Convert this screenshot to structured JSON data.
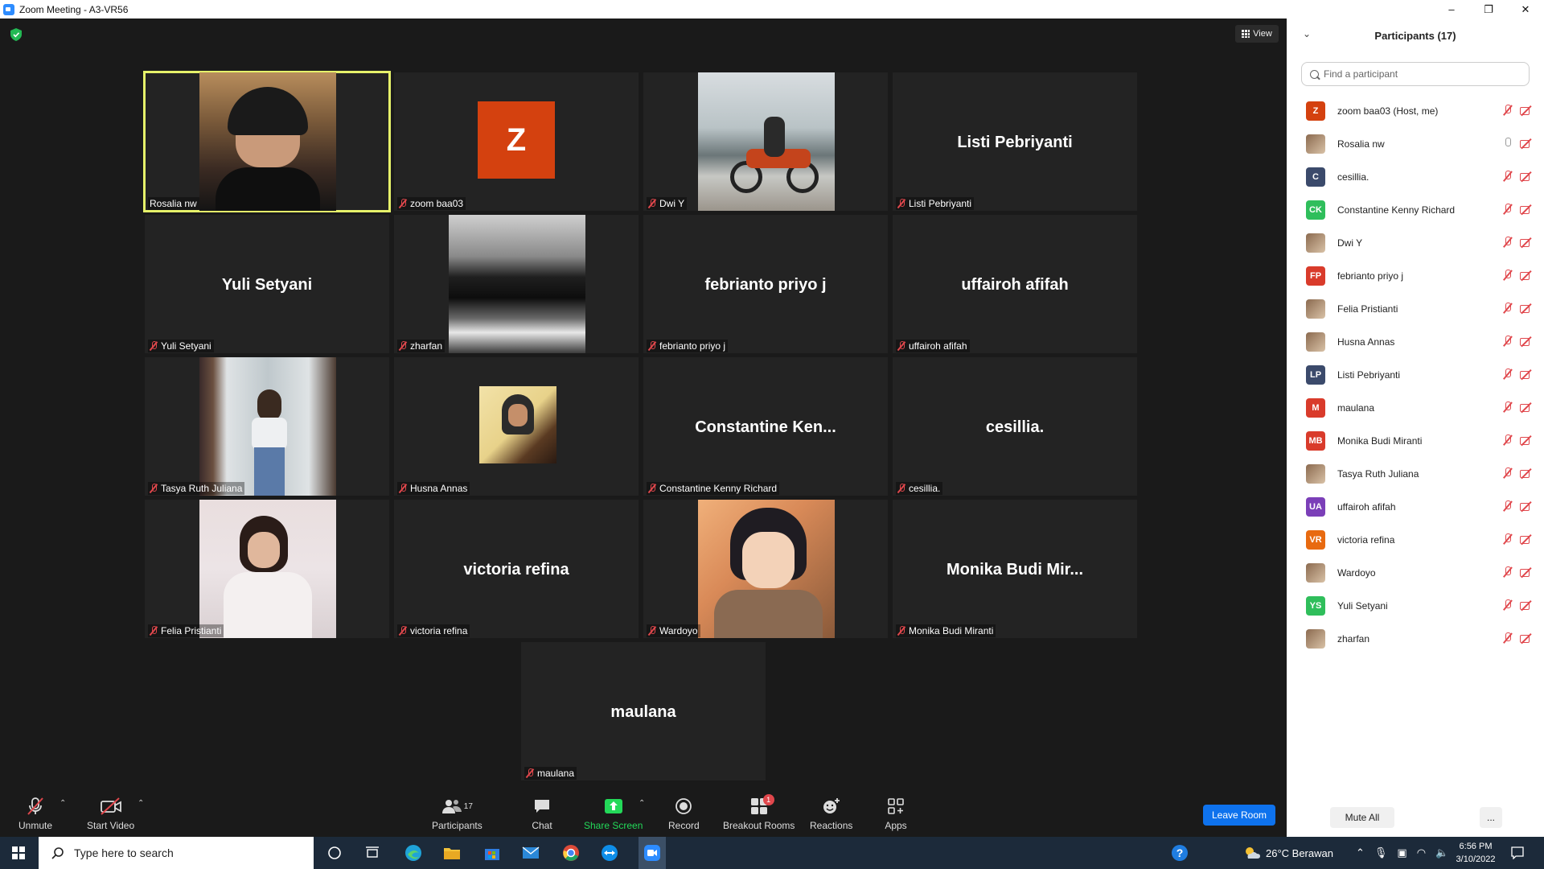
{
  "window": {
    "title": "Zoom Meeting - A3-VR56",
    "minimize": "–",
    "restore": "❐",
    "close": "✕"
  },
  "view_button": "View",
  "tiles": [
    {
      "name": "Rosalia nw",
      "display": "",
      "kind": "video"
    },
    {
      "name": "zoom baa03",
      "display": "",
      "kind": "avatar",
      "initial": "Z"
    },
    {
      "name": "Dwi Y",
      "display": "",
      "kind": "video"
    },
    {
      "name": "Listi Pebriyanti",
      "display": "Listi Pebriyanti",
      "kind": "name"
    },
    {
      "name": "Yuli Setyani",
      "display": "Yuli Setyani",
      "kind": "name"
    },
    {
      "name": "zharfan",
      "display": "",
      "kind": "video"
    },
    {
      "name": "febrianto priyo j",
      "display": "febrianto priyo j",
      "kind": "name"
    },
    {
      "name": "uffairoh afifah",
      "display": "uffairoh afifah",
      "kind": "name"
    },
    {
      "name": "Tasya Ruth Juliana",
      "display": "",
      "kind": "video"
    },
    {
      "name": "Husna Annas",
      "display": "",
      "kind": "video"
    },
    {
      "name": "Constantine Kenny Richard",
      "display": "Constantine  Ken...",
      "kind": "name"
    },
    {
      "name": "cesillia.",
      "display": "cesillia.",
      "kind": "name"
    },
    {
      "name": "Felia Pristianti",
      "display": "",
      "kind": "video"
    },
    {
      "name": "victoria refina",
      "display": "victoria refina",
      "kind": "name"
    },
    {
      "name": "Wardoyo",
      "display": "",
      "kind": "video"
    },
    {
      "name": "Monika Budi Miranti",
      "display": "Monika  Budi  Mir...",
      "kind": "name"
    },
    {
      "name": "maulana",
      "display": "maulana",
      "kind": "name"
    }
  ],
  "toolbar": {
    "unmute": "Unmute",
    "start_video": "Start Video",
    "participants": "Participants",
    "participants_count": "17",
    "chat": "Chat",
    "share_screen": "Share Screen",
    "record": "Record",
    "breakout_rooms": "Breakout Rooms",
    "breakout_badge": "1",
    "reactions": "Reactions",
    "apps": "Apps",
    "leave": "Leave Room"
  },
  "panel": {
    "title": "Participants (17)",
    "search_placeholder": "Find a participant",
    "mute_all": "Mute All",
    "more": "...",
    "participants": [
      {
        "name": "zoom baa03 (Host, me)",
        "initials": "Z",
        "color": "#d4410f",
        "mic": "muted"
      },
      {
        "name": "Rosalia nw",
        "initials": "",
        "color": "",
        "mic": "on"
      },
      {
        "name": "cesillia.",
        "initials": "C",
        "color": "#3b4a6b",
        "mic": "muted"
      },
      {
        "name": "Constantine Kenny Richard",
        "initials": "CK",
        "color": "#2fbe5b",
        "mic": "muted"
      },
      {
        "name": "Dwi Y",
        "initials": "",
        "color": "",
        "mic": "muted"
      },
      {
        "name": "febrianto priyo j",
        "initials": "FP",
        "color": "#d93b2b",
        "mic": "muted"
      },
      {
        "name": "Felia Pristianti",
        "initials": "",
        "color": "",
        "mic": "muted"
      },
      {
        "name": "Husna Annas",
        "initials": "",
        "color": "",
        "mic": "muted"
      },
      {
        "name": "Listi Pebriyanti",
        "initials": "LP",
        "color": "#3b4a6b",
        "mic": "muted"
      },
      {
        "name": "maulana",
        "initials": "M",
        "color": "#d93b2b",
        "mic": "muted"
      },
      {
        "name": "Monika Budi Miranti",
        "initials": "MB",
        "color": "#d93b2b",
        "mic": "muted"
      },
      {
        "name": "Tasya Ruth Juliana",
        "initials": "",
        "color": "",
        "mic": "muted"
      },
      {
        "name": "uffairoh afifah",
        "initials": "UA",
        "color": "#7b3fb8",
        "mic": "muted"
      },
      {
        "name": "victoria refina",
        "initials": "VR",
        "color": "#e86a10",
        "mic": "muted"
      },
      {
        "name": "Wardoyo",
        "initials": "",
        "color": "",
        "mic": "muted"
      },
      {
        "name": "Yuli Setyani",
        "initials": "YS",
        "color": "#2fbe5b",
        "mic": "muted"
      },
      {
        "name": "zharfan",
        "initials": "",
        "color": "",
        "mic": "muted"
      }
    ]
  },
  "taskbar": {
    "search_placeholder": "Type here to search",
    "weather": "26°C  Berawan",
    "time": "6:56 PM",
    "date": "3/10/2022"
  },
  "colors": {
    "accent": "#0e72ed",
    "muted": "#e0474c",
    "active_speaker": "#e6f26a",
    "share_green": "#23d959"
  }
}
